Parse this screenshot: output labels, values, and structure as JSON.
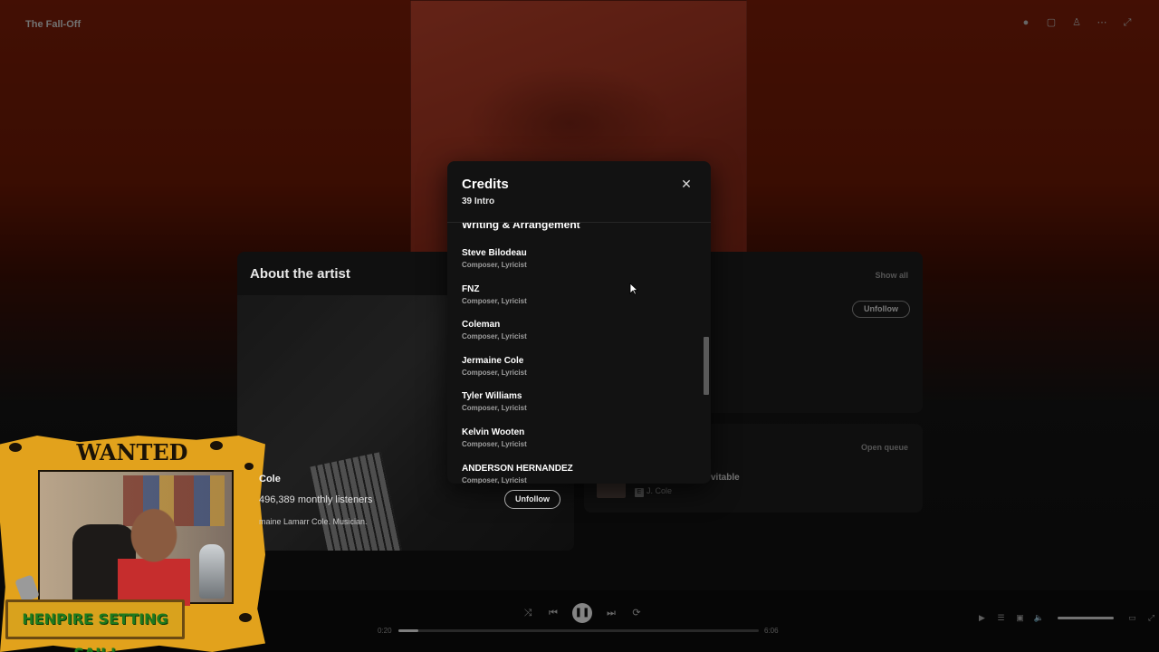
{
  "app": {
    "title": "The Fall-Off"
  },
  "about_artist": {
    "heading": "About the artist",
    "artist_name": "Cole",
    "monthly_listeners": "496,389 monthly listeners",
    "bio": "maine Lamarr Cole. Musician.",
    "follow_label": "Unfollow"
  },
  "credits_card": {
    "show_all_label": "Show all",
    "follow_label": "Unfollow"
  },
  "queue_card": {
    "open_queue_label": "Open queue",
    "next_title": "vitable",
    "explicit_badge": "E",
    "next_artist": "J. Cole"
  },
  "player": {
    "time_elapsed": "0:20",
    "time_total": "6:06",
    "progress": 0.055
  },
  "modal": {
    "title": "Credits",
    "subtitle": "39 Intro",
    "section_title": "Writing & Arrangement",
    "credits": [
      {
        "name": "Steve Bilodeau",
        "role": "Composer, Lyricist"
      },
      {
        "name": "FNZ",
        "role": "Composer, Lyricist"
      },
      {
        "name": "Coleman",
        "role": "Composer, Lyricist"
      },
      {
        "name": "Jermaine Cole",
        "role": "Composer, Lyricist"
      },
      {
        "name": "Tyler Williams",
        "role": "Composer, Lyricist"
      },
      {
        "name": "Kelvin Wooten",
        "role": "Composer, Lyricist"
      },
      {
        "name": "ANDERSON HERNANDEZ",
        "role": "Composer, Lyricist"
      }
    ]
  },
  "overlay": {
    "poster_heading": "WANTED",
    "sign_text": "HENPIRE SETTING SAIL!"
  },
  "colors": {
    "background_top": "#7a1d08",
    "modal_bg": "#121212",
    "poster": "#e2a21c",
    "sign_text": "#1e7a1e"
  }
}
